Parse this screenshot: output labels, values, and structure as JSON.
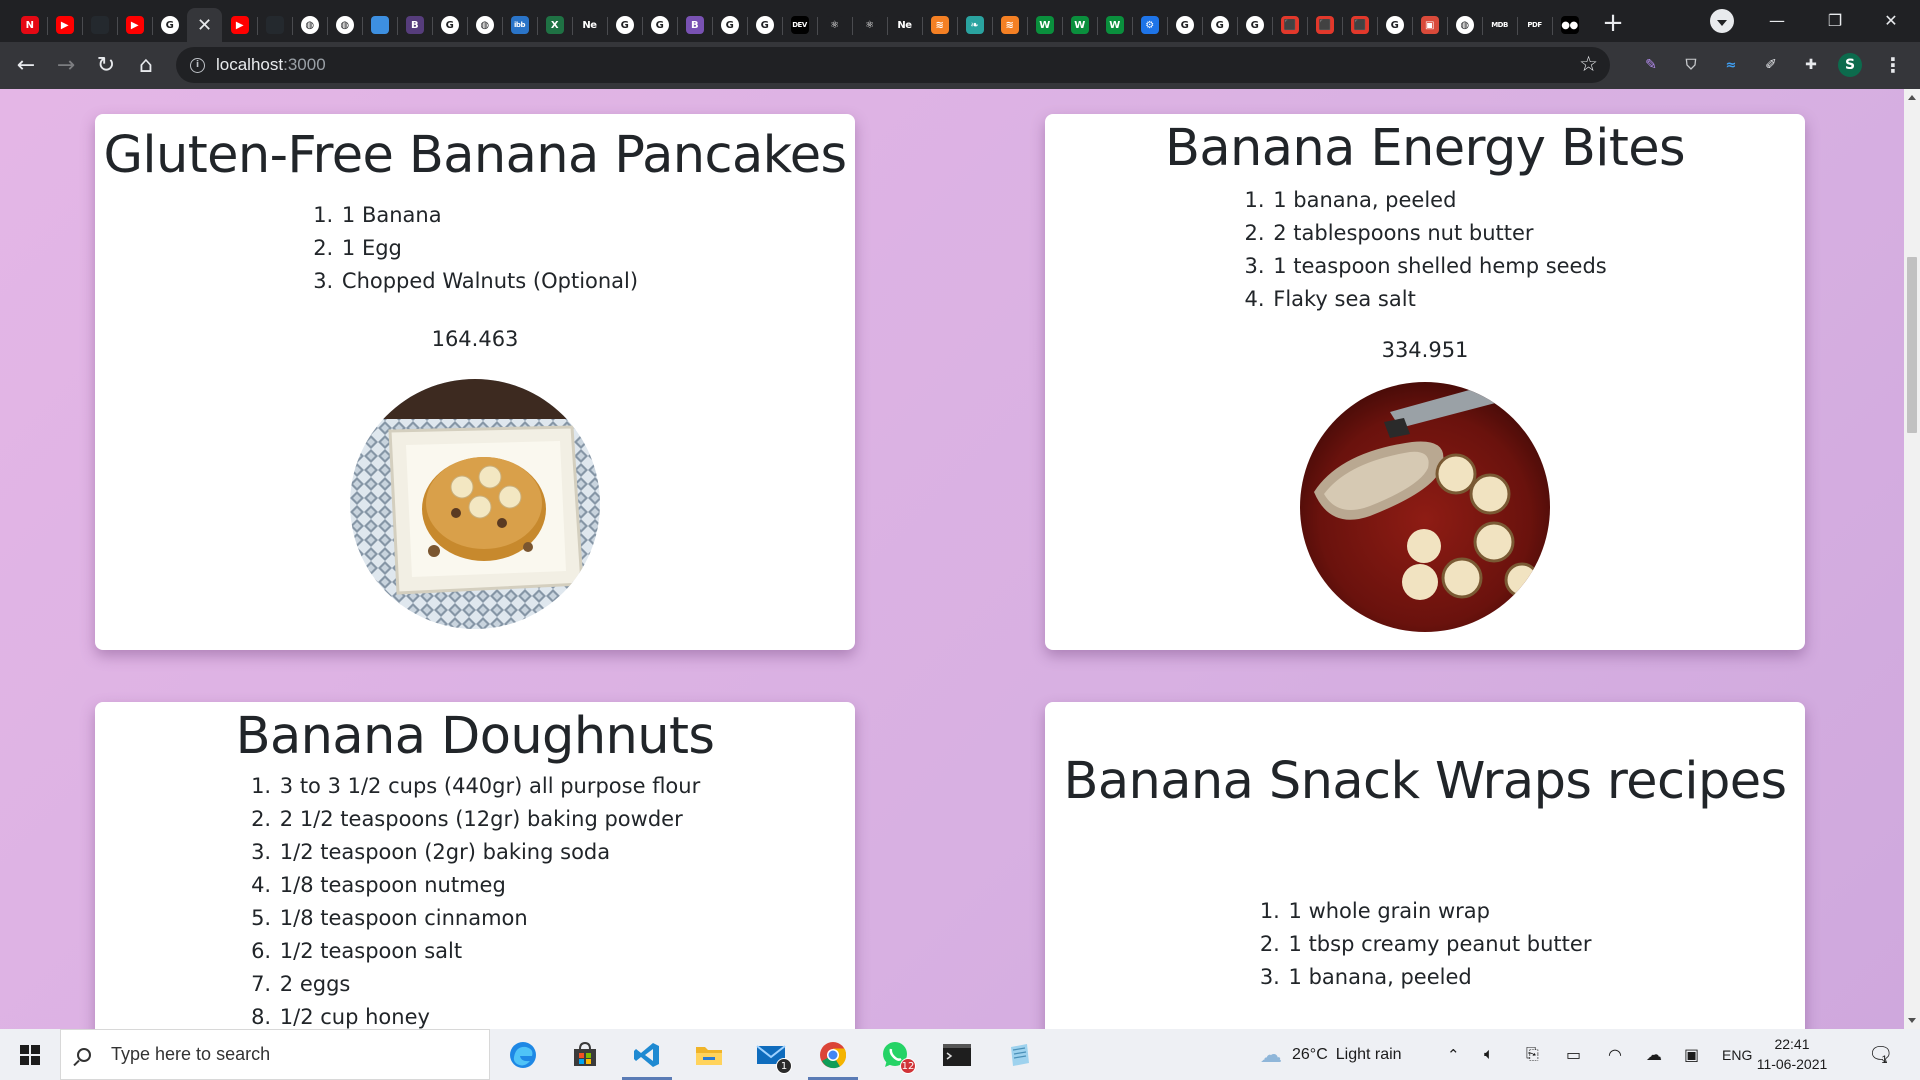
{
  "browser": {
    "tabs": [
      {
        "icon": "netflix-icon",
        "glyph": "N",
        "color": "#e50914"
      },
      {
        "icon": "youtube-icon",
        "glyph": "▶",
        "color": "#ff0000"
      },
      {
        "icon": "github-icon",
        "glyph": "",
        "color": "#24292e"
      },
      {
        "icon": "youtube-icon",
        "glyph": "▶",
        "color": "#ff0000"
      },
      {
        "icon": "google-icon",
        "glyph": "G",
        "color": "#ffffff"
      },
      {
        "icon": "close-icon",
        "glyph": "✕",
        "color": "",
        "active": true
      },
      {
        "icon": "youtube-icon",
        "glyph": "▶",
        "color": "#ff0000"
      },
      {
        "icon": "github-icon",
        "glyph": "",
        "color": "#24292e"
      },
      {
        "icon": "globe-icon",
        "glyph": "◍",
        "color": "#ffffff"
      },
      {
        "icon": "globe-icon",
        "glyph": "◍",
        "color": "#ffffff"
      },
      {
        "icon": "edge-icon",
        "glyph": "",
        "color": "#3d8fe0"
      },
      {
        "icon": "bootstrap-icon",
        "glyph": "B",
        "color": "#563d7c"
      },
      {
        "icon": "google-icon",
        "glyph": "G",
        "color": "#ffffff"
      },
      {
        "icon": "globe-icon",
        "glyph": "◍",
        "color": "#ffffff"
      },
      {
        "icon": "ibb-icon",
        "glyph": "ibb",
        "color": "#2a74c8"
      },
      {
        "icon": "excel-icon",
        "glyph": "X",
        "color": "#1f7244"
      },
      {
        "icon": "text-icon",
        "glyph": "Ne",
        "color": "#202124"
      },
      {
        "icon": "google-icon",
        "glyph": "G",
        "color": "#ffffff"
      },
      {
        "icon": "google-icon",
        "glyph": "G",
        "color": "#ffffff"
      },
      {
        "icon": "bootstrap-icon",
        "glyph": "B",
        "color": "#7952b3"
      },
      {
        "icon": "google-icon",
        "glyph": "G",
        "color": "#ffffff"
      },
      {
        "icon": "google-icon",
        "glyph": "G",
        "color": "#ffffff"
      },
      {
        "icon": "dev-icon",
        "glyph": "DEV",
        "color": "#000000"
      },
      {
        "icon": "react-icon",
        "glyph": "⚛",
        "color": "#202124"
      },
      {
        "icon": "react-icon",
        "glyph": "⚛",
        "color": "#202124"
      },
      {
        "icon": "text-icon",
        "glyph": "Ne",
        "color": "#202124"
      },
      {
        "icon": "stackoverflow-icon",
        "glyph": "≋",
        "color": "#f48024"
      },
      {
        "icon": "bird-icon",
        "glyph": "❧",
        "color": "#2aa3a0"
      },
      {
        "icon": "stackoverflow-icon",
        "glyph": "≋",
        "color": "#f48024"
      },
      {
        "icon": "w-icon",
        "glyph": "W",
        "color": "#0a8f3d"
      },
      {
        "icon": "w-icon",
        "glyph": "W",
        "color": "#0a8f3d"
      },
      {
        "icon": "w-icon",
        "glyph": "W",
        "color": "#0a8f3d"
      },
      {
        "icon": "gear-blue-icon",
        "glyph": "⚙",
        "color": "#1e74e8"
      },
      {
        "icon": "google-icon",
        "glyph": "G",
        "color": "#ffffff"
      },
      {
        "icon": "google-icon",
        "glyph": "G",
        "color": "#ffffff"
      },
      {
        "icon": "google-icon",
        "glyph": "G",
        "color": "#ffffff"
      },
      {
        "icon": "pdf-icon",
        "glyph": "⬛",
        "color": "#e2382b"
      },
      {
        "icon": "pdf-icon",
        "glyph": "⬛",
        "color": "#e2382b"
      },
      {
        "icon": "pdf-icon",
        "glyph": "⬛",
        "color": "#e2382b"
      },
      {
        "icon": "google-icon",
        "glyph": "G",
        "color": "#ffffff"
      },
      {
        "icon": "drive-icon",
        "glyph": "▣",
        "color": "#d94a3a"
      },
      {
        "icon": "globe-icon",
        "glyph": "◍",
        "color": "#ffffff"
      },
      {
        "icon": "mdb-icon",
        "glyph": "MDB",
        "color": "#202124"
      },
      {
        "icon": "pdf-small-icon",
        "glyph": "PDF",
        "color": "#202124"
      },
      {
        "icon": "medium-icon",
        "glyph": "●●",
        "color": "#000000"
      }
    ],
    "new_tab": "+",
    "address": {
      "host": "localhost",
      "port": ":3000"
    },
    "profile_initial": "S",
    "window_buttons": {
      "minimize": "—",
      "maximize": "❐",
      "close": "✕"
    }
  },
  "recipes": [
    {
      "title": "Gluten-Free Banana Pancakes",
      "ingredients": [
        "1 Banana",
        "1 Egg",
        "Chopped Walnuts (Optional)"
      ],
      "score": "164.463",
      "photo": "pancake-photo"
    },
    {
      "title": "Banana Energy Bites",
      "ingredients": [
        "1 banana, peeled",
        "2 tablespoons nut butter",
        "1 teaspoon shelled hemp seeds",
        "Flaky sea salt"
      ],
      "score": "334.951",
      "photo": "energy-bites-photo"
    },
    {
      "title": "Banana Doughnuts",
      "ingredients": [
        "3 to 3 1/2 cups (440gr) all purpose flour",
        "2 1/2 teaspoons (12gr) baking powder",
        "1/2 teaspoon (2gr) baking soda",
        "1/8 teaspoon nutmeg",
        "1/8 teaspoon cinnamon",
        "1/2 teaspoon salt",
        "2 eggs",
        "1/2 cup honey"
      ]
    },
    {
      "title": "Banana Snack Wraps recipes",
      "ingredients": [
        "1 whole grain wrap",
        "1 tbsp creamy peanut butter",
        "1 banana, peeled"
      ]
    }
  ],
  "taskbar": {
    "search_placeholder": "Type here to search",
    "apps": [
      {
        "name": "edge-icon"
      },
      {
        "name": "store-icon"
      },
      {
        "name": "vscode-icon"
      },
      {
        "name": "file-explorer-icon"
      },
      {
        "name": "mail-icon",
        "badge": "1"
      },
      {
        "name": "chrome-icon"
      },
      {
        "name": "whatsapp-icon",
        "badge": "12"
      },
      {
        "name": "terminal-icon"
      },
      {
        "name": "notepad-icon"
      }
    ],
    "weather": {
      "temp": "26°C",
      "desc": "Light rain"
    },
    "language": "ENG",
    "time": "22:41",
    "date": "11-06-2021",
    "notification_count": "1"
  }
}
